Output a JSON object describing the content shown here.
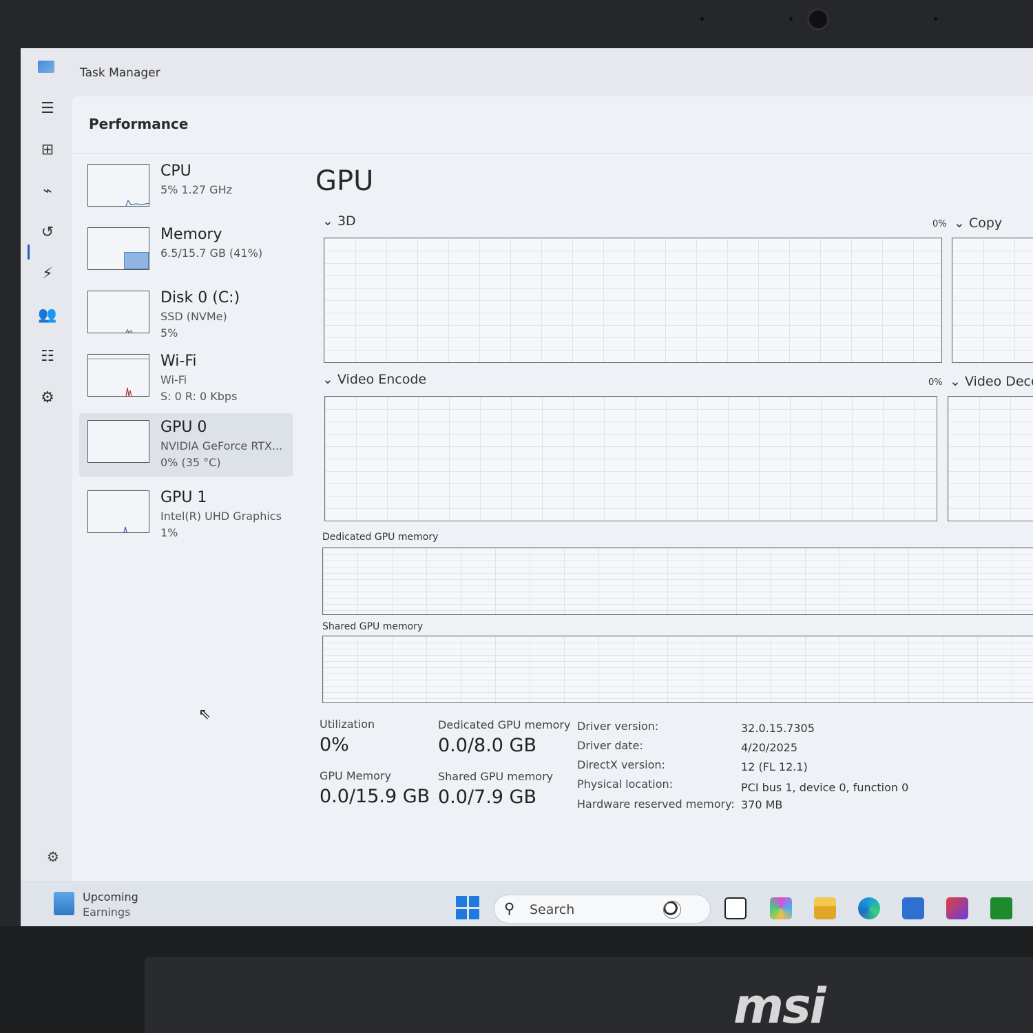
{
  "window": {
    "title": "Task Manager"
  },
  "page": {
    "title": "Performance"
  },
  "nav": [
    {
      "name": "menu-icon",
      "glyph": "☰"
    },
    {
      "name": "processes-icon",
      "glyph": "⊞"
    },
    {
      "name": "performance-icon",
      "glyph": "⌁"
    },
    {
      "name": "app-history-icon",
      "glyph": "↺"
    },
    {
      "name": "startup-apps-icon",
      "glyph": "⚡"
    },
    {
      "name": "users-icon",
      "glyph": "👥"
    },
    {
      "name": "details-icon",
      "glyph": "☷"
    },
    {
      "name": "services-icon",
      "glyph": "⚙"
    }
  ],
  "settings_icon": "⚙",
  "resources": [
    {
      "name": "CPU",
      "sub1": "5%  1.27 GHz",
      "sub2": ""
    },
    {
      "name": "Memory",
      "sub1": "6.5/15.7 GB (41%)",
      "sub2": ""
    },
    {
      "name": "Disk 0 (C:)",
      "sub1": "SSD (NVMe)",
      "sub2": "5%"
    },
    {
      "name": "Wi-Fi",
      "sub1": "Wi-Fi",
      "sub2": "S: 0  R: 0 Kbps"
    },
    {
      "name": "GPU 0",
      "sub1": "NVIDIA GeForce RTX...",
      "sub2": "0%  (35 °C)"
    },
    {
      "name": "GPU 1",
      "sub1": "Intel(R) UHD Graphics",
      "sub2": "1%"
    }
  ],
  "memory_in_use_fraction": 0.41,
  "gpu": {
    "title": "GPU",
    "engines": {
      "e3d": {
        "label": "3D",
        "pct": "0%"
      },
      "copy": {
        "label": "Copy"
      },
      "encode": {
        "label": "Video Encode",
        "pct": "0%"
      },
      "decode": {
        "label": "Video Deco"
      }
    },
    "dedicated_label": "Dedicated GPU memory",
    "shared_label": "Shared GPU memory",
    "stats": {
      "utilization_label": "Utilization",
      "utilization_value": "0%",
      "dedicated_label": "Dedicated GPU memory",
      "dedicated_value": "0.0/8.0 GB",
      "gpu_memory_label": "GPU Memory",
      "gpu_memory_value": "0.0/15.9 GB",
      "shared_label": "Shared GPU memory",
      "shared_value": "0.0/7.9 GB"
    },
    "info": [
      {
        "label": "Driver version:",
        "value": "32.0.15.7305"
      },
      {
        "label": "Driver date:",
        "value": "4/20/2025"
      },
      {
        "label": "DirectX version:",
        "value": "12 (FL 12.1)"
      },
      {
        "label": "Physical location:",
        "value": "PCI bus 1, device 0, function 0"
      },
      {
        "label": "Hardware reserved memory:",
        "value": "370 MB"
      }
    ]
  },
  "taskbar": {
    "widget_line1": "Upcoming",
    "widget_line2": "Earnings",
    "search_placeholder": "Search"
  },
  "brand": "msi",
  "colors": {
    "accent": "#1f5fbf",
    "graph_border": "#6b6b6b",
    "memory_fill": "#8fb5e3"
  }
}
